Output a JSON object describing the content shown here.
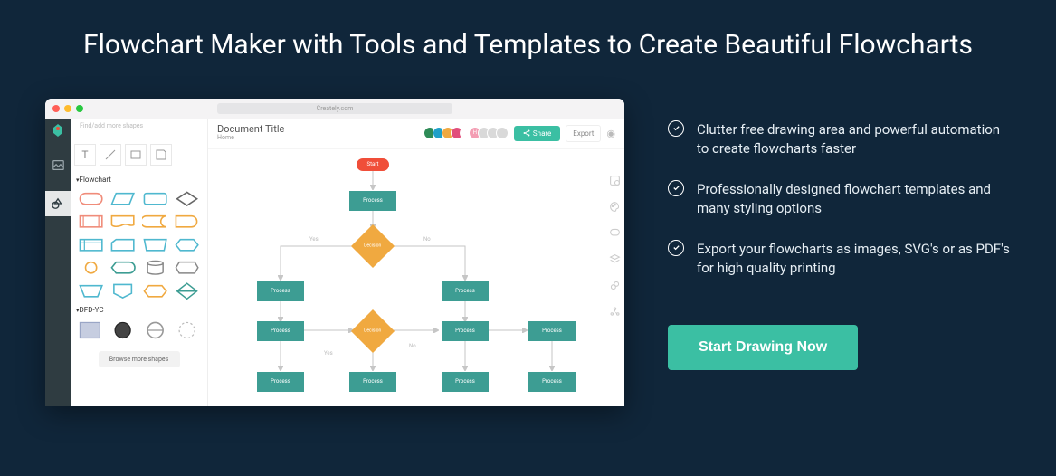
{
  "headline": "Flowchart Maker with Tools and Templates to Create Beautiful Flowcharts",
  "features": [
    "Clutter free drawing area and powerful automation to create flowcharts faster",
    "Professionally designed flowchart templates and many styling options",
    "Export your flowcharts as images, SVG's or as PDF's for high quality printing"
  ],
  "cta": "Start Drawing Now",
  "app": {
    "url": "Creately.com",
    "searchPlaceholder": "Find/add more shapes",
    "docTitle": "Document Title",
    "breadcrumb": "Home",
    "shareLabel": "Share",
    "exportLabel": "Export",
    "quickTools": [
      "T",
      "\\",
      "▭",
      "▢"
    ],
    "categories": [
      "Flowchart",
      "DFD-YC"
    ],
    "browse": "Browse more shapes",
    "avatarColors": [
      "#2e8b57",
      "#1fa0c9",
      "#f0a940",
      "#e14e7b",
      "#ffffff",
      "#f39db3",
      "#d0d0d0",
      "#d0d0d0",
      "#d0d0d0"
    ],
    "avatarInitials": [
      "",
      "",
      "",
      "",
      "H",
      "",
      "",
      "",
      ""
    ],
    "nodes": {
      "start": "Start",
      "process": "Process",
      "decision": "Decision"
    },
    "edgeLabels": {
      "yes": "Yes",
      "no": "No"
    }
  }
}
